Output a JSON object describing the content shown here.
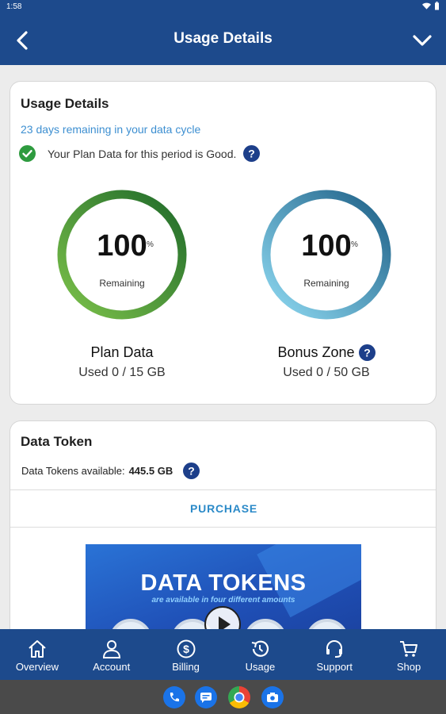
{
  "status_bar": {
    "time": "1:58"
  },
  "header": {
    "title": "Usage Details",
    "back_icon": "chevron-left-icon",
    "collapse_icon": "chevron-down-icon"
  },
  "usage_card": {
    "title": "Usage Details",
    "cycle_text": "23 days remaining in your data cycle",
    "status_text": "Your Plan Data for this period is Good.",
    "meters": [
      {
        "value": "100",
        "unit": "%",
        "caption": "Remaining",
        "label": "Plan Data",
        "used": "Used 0 / 15 GB",
        "percent_remaining": 100,
        "colors": [
          "#7cc14a",
          "#1f6a2a"
        ]
      },
      {
        "value": "100",
        "unit": "%",
        "caption": "Remaining",
        "label": "Bonus Zone",
        "used": "Used 0 / 50 GB",
        "percent_remaining": 100,
        "colors": [
          "#8fdaf2",
          "#1d5f86"
        ]
      }
    ]
  },
  "token_card": {
    "title": "Data Token",
    "available_label": "Data Tokens available:",
    "available_value": "445.5 GB",
    "purchase_label": "PURCHASE",
    "promo": {
      "title": "DATA TOKENS",
      "subtitle": "are available in four different amounts"
    }
  },
  "bottom_nav": [
    {
      "label": "Overview",
      "icon": "home-icon"
    },
    {
      "label": "Account",
      "icon": "person-icon"
    },
    {
      "label": "Billing",
      "icon": "dollar-icon"
    },
    {
      "label": "Usage",
      "icon": "history-icon"
    },
    {
      "label": "Support",
      "icon": "headset-icon"
    },
    {
      "label": "Shop",
      "icon": "cart-icon"
    }
  ],
  "colors": {
    "brand": "#1d4a8c",
    "good": "#2e9b3f",
    "link": "#3d8fd1",
    "help": "#1d3f8a"
  }
}
